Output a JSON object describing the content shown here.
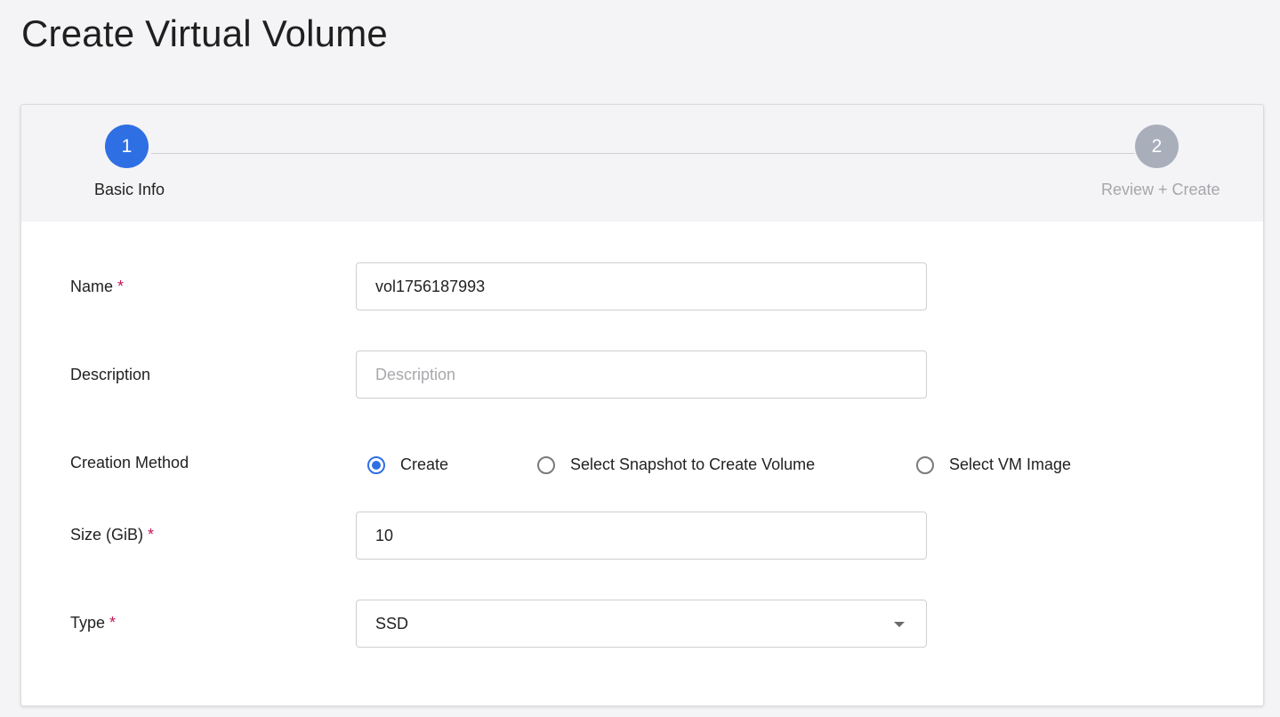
{
  "page": {
    "title": "Create Virtual Volume"
  },
  "stepper": {
    "steps": [
      {
        "number": "1",
        "label": "Basic Info",
        "state": "active"
      },
      {
        "number": "2",
        "label": "Review + Create",
        "state": "inactive"
      }
    ]
  },
  "form": {
    "name": {
      "label": "Name",
      "required_mark": "*",
      "value": "vol1756187993"
    },
    "description": {
      "label": "Description",
      "value": "",
      "placeholder": "Description"
    },
    "creation_method": {
      "label": "Creation Method",
      "options": [
        {
          "label": "Create",
          "checked": true
        },
        {
          "label": "Select Snapshot to Create Volume",
          "checked": false
        },
        {
          "label": "Select VM Image",
          "checked": false
        }
      ]
    },
    "size": {
      "label": "Size (GiB)",
      "required_mark": "*",
      "value": "10"
    },
    "type": {
      "label": "Type",
      "required_mark": "*",
      "selected": "SSD"
    }
  },
  "colors": {
    "accent": "#2f6fe4",
    "required": "#c2185b",
    "inactive_step": "#a9aebb"
  }
}
